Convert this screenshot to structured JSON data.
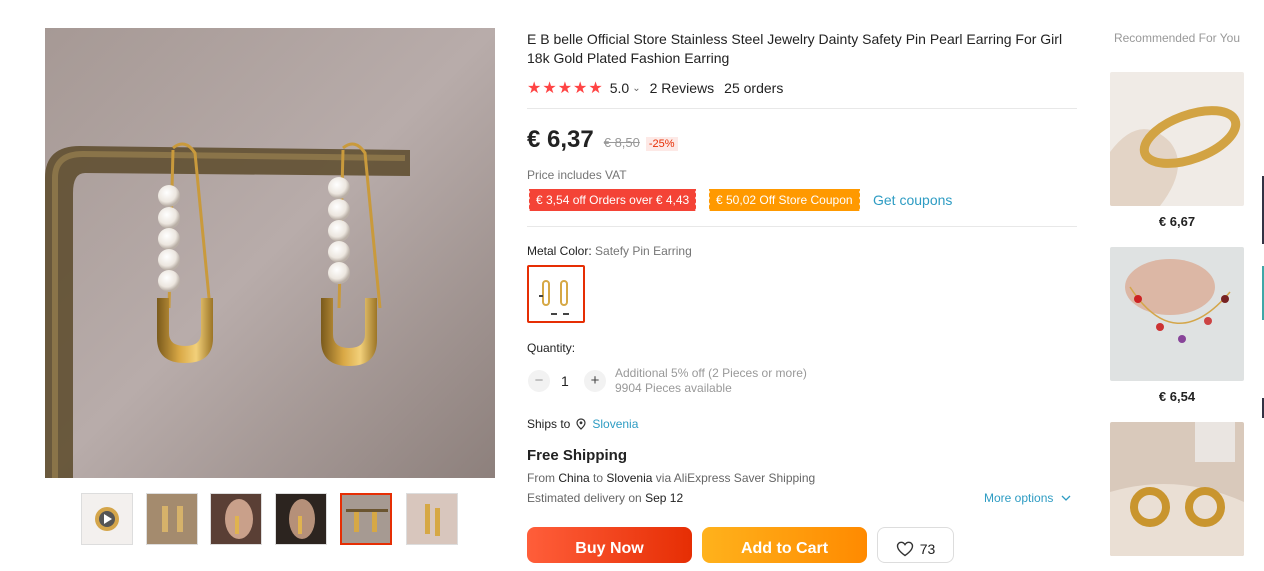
{
  "product": {
    "title": "E B belle Official Store Stainless Steel Jewelry Dainty Safety Pin Pearl Earring For Girl 18k Gold Plated Fashion Earring",
    "rating": {
      "stars": 5,
      "value": "5.0",
      "reviews": "2 Reviews",
      "orders": "25 orders"
    },
    "price": "€ 6,37",
    "old_price": "€ 8,50",
    "discount": "-25%",
    "vat_note": "Price includes VAT",
    "coupons": [
      {
        "label": "€ 3,54 off Orders over € 4,43",
        "color": "#f44336"
      },
      {
        "label": "€ 50,02 Off Store Coupon",
        "color": "#ff9900"
      }
    ],
    "get_coupons": "Get coupons",
    "metal_color_label": "Metal Color:",
    "metal_color_value": "Satefy Pin Earring",
    "quantity_label": "Quantity:",
    "quantity": "1",
    "quantity_note_1": "Additional 5% off (2 Pieces or more)",
    "quantity_note_2": "9904 Pieces available",
    "ships_to_label": "Ships to",
    "ships_to_country": "Slovenia",
    "free_shipping": "Free Shipping",
    "ship_from_1": "From",
    "ship_from_country": "China",
    "ship_from_2": "to",
    "ship_to_country": "Slovenia",
    "ship_from_3": "via AliExpress Saver Shipping",
    "delivery_label": "Estimated delivery on",
    "delivery_date": "Sep 12",
    "more_options": "More options",
    "buy_now": "Buy Now",
    "add_to_cart": "Add to Cart",
    "wishlist_count": "73"
  },
  "gallery": {
    "thumbnail_count": 6,
    "selected_index": 4
  },
  "recommended": {
    "title": "Recommended For You",
    "items": [
      {
        "price": "€ 6,67"
      },
      {
        "price": "€ 6,54"
      },
      {
        "price": ""
      }
    ]
  },
  "colors": {
    "accent": "#e62e04",
    "link": "#2e9cc3",
    "star": "#ff4747"
  }
}
